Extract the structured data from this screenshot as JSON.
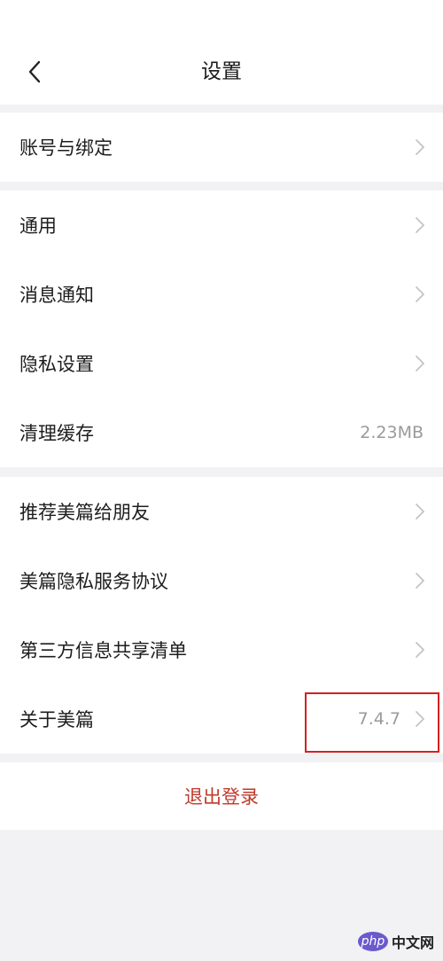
{
  "header": {
    "title": "设置",
    "back_icon": "chevron-left-icon"
  },
  "groups": [
    {
      "items": [
        {
          "label": "账号与绑定",
          "value": "",
          "chevron": true
        }
      ]
    },
    {
      "items": [
        {
          "label": "通用",
          "value": "",
          "chevron": true
        },
        {
          "label": "消息通知",
          "value": "",
          "chevron": true
        },
        {
          "label": "隐私设置",
          "value": "",
          "chevron": true
        },
        {
          "label": "清理缓存",
          "value": "2.23MB",
          "chevron": false
        }
      ]
    },
    {
      "items": [
        {
          "label": "推荐美篇给朋友",
          "value": "",
          "chevron": true
        },
        {
          "label": "美篇隐私服务协议",
          "value": "",
          "chevron": true
        },
        {
          "label": "第三方信息共享清单",
          "value": "",
          "chevron": true
        },
        {
          "label": "关于美篇",
          "value": "7.4.7",
          "chevron": true
        }
      ]
    }
  ],
  "logout": {
    "label": "退出登录"
  },
  "watermark": {
    "badge": "php",
    "text": "中文网"
  },
  "colors": {
    "background": "#f2f2f4",
    "surface": "#ffffff",
    "text": "#1d1d1d",
    "secondary_text": "#9a9a9a",
    "logout_text": "#c0392b",
    "highlight_border": "#d42020"
  }
}
